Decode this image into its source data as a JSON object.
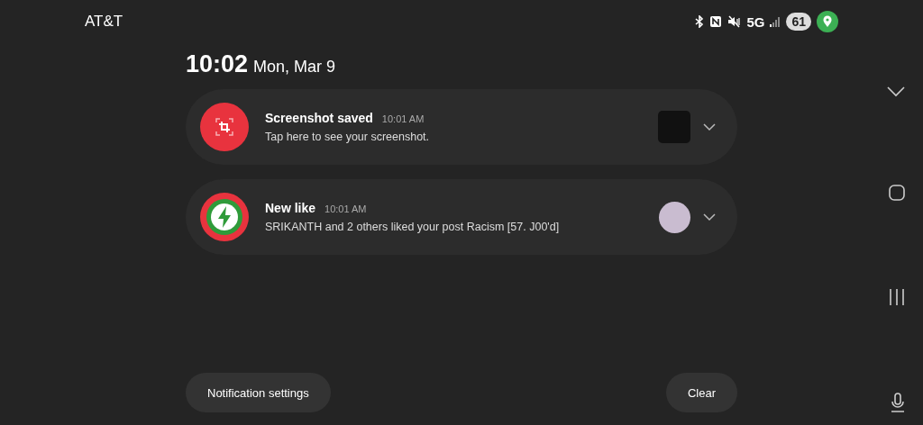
{
  "status_bar": {
    "carrier": "AT&T",
    "network": "5G",
    "battery": "61"
  },
  "header": {
    "time": "10:02",
    "date": "Mon, Mar 9"
  },
  "notifications": [
    {
      "kind": "screenshot",
      "title": "Screenshot saved",
      "time": "10:01 AM",
      "text": "Tap here to see your screenshot.",
      "expanded": false
    },
    {
      "kind": "like",
      "title": "New like",
      "time": "10:01 AM",
      "text": "SRIKANTH and 2 others liked your post Racism [57. J00'd]",
      "expanded": false
    }
  ],
  "buttons": {
    "settings": "Notification settings",
    "clear": "Clear"
  }
}
